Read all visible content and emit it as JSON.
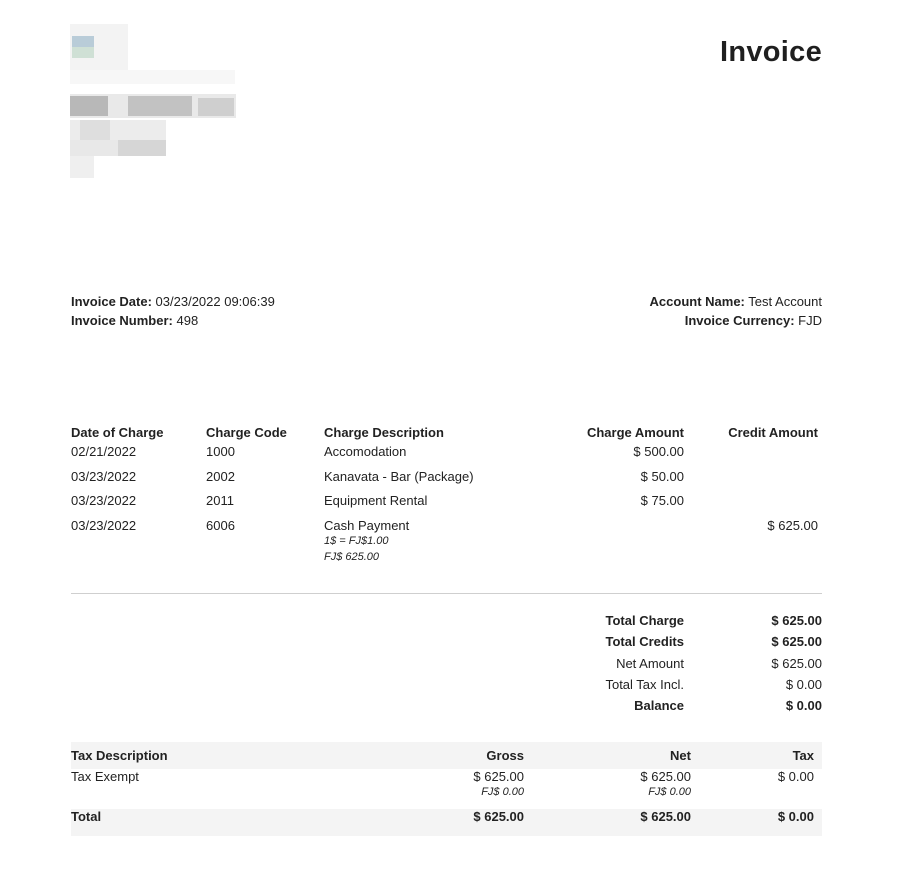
{
  "header": {
    "title": "Invoice"
  },
  "invoice": {
    "date_label": "Invoice Date:",
    "date_value": "03/23/2022 09:06:39",
    "number_label": "Invoice Number:",
    "number_value": "498",
    "account_label": "Account Name:",
    "account_value": "Test Account",
    "currency_label": "Invoice Currency:",
    "currency_value": "FJD"
  },
  "charges": {
    "headers": {
      "date": "Date of Charge",
      "code": "Charge Code",
      "description": "Charge Description",
      "charge": "Charge Amount",
      "credit": "Credit Amount"
    },
    "rows": [
      {
        "date": "02/21/2022",
        "code": "1000",
        "description": "Accomodation",
        "charge": "$ 500.00",
        "credit": ""
      },
      {
        "date": "03/23/2022",
        "code": "2002",
        "description": "Kanavata - Bar (Package)",
        "charge": "$ 50.00",
        "credit": ""
      },
      {
        "date": "03/23/2022",
        "code": "2011",
        "description": "Equipment Rental",
        "charge": "$ 75.00",
        "credit": ""
      },
      {
        "date": "03/23/2022",
        "code": "6006",
        "description": "Cash Payment",
        "rate": "1$ = FJ$1.00",
        "converted": "FJ$ 625.00",
        "charge": "",
        "credit": "$ 625.00"
      }
    ]
  },
  "totals": {
    "total_charge_label": "Total Charge",
    "total_charge_value": "$ 625.00",
    "total_credits_label": "Total Credits",
    "total_credits_value": "$ 625.00",
    "net_amount_label": "Net Amount",
    "net_amount_value": "$ 625.00",
    "total_tax_label": "Total Tax Incl.",
    "total_tax_value": "$ 0.00",
    "balance_label": "Balance",
    "balance_value": "$ 0.00"
  },
  "tax": {
    "headers": {
      "description": "Tax Description",
      "gross": "Gross",
      "net": "Net",
      "tax": "Tax"
    },
    "rows": [
      {
        "description": "Tax Exempt",
        "gross": "$ 625.00",
        "gross_fj": "FJ$ 0.00",
        "net": "$ 625.00",
        "net_fj": "FJ$ 0.00",
        "tax": "$ 0.00"
      }
    ],
    "total": {
      "label": "Total",
      "gross": "$ 625.00",
      "net": "$ 625.00",
      "tax": "$ 0.00"
    }
  }
}
